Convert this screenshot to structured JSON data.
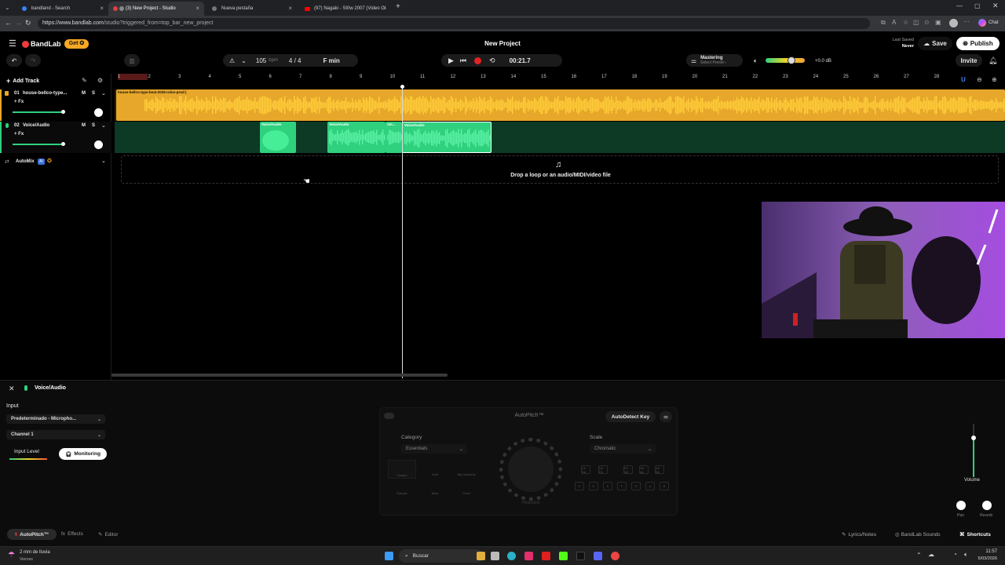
{
  "browser": {
    "tabs": [
      {
        "label": "bandland - Search",
        "active": false
      },
      {
        "label": "(3) New Project - Studio",
        "active": true
      },
      {
        "label": "Nueva pestaña",
        "active": false
      },
      {
        "label": "(97) Nagaki - SI0w 2007 (Video Cl",
        "active": false
      }
    ],
    "url_host": "https://www.bandlab.com",
    "url_path": "/studio?triggered_from=top_bar_new_project",
    "chat_label": "Chat"
  },
  "header": {
    "brand": "BandLab",
    "get_label": "Get ✪",
    "project_title": "New Project",
    "last_saved_label": "Last Saved",
    "last_saved_value": "Never",
    "save_label": "Save",
    "publish_label": "Publish",
    "invite_label": "Invite"
  },
  "transport": {
    "bpm": "105",
    "bpm_unit": "bpm",
    "time_signature": "4 / 4",
    "key": "F min",
    "time": "00:21.7",
    "mastering_label": "Mastering",
    "mastering_preset": "Select Preset ›",
    "volume_db": "+0.0 dB"
  },
  "ruler": {
    "ticks": [
      "1",
      "2",
      "3",
      "4",
      "5",
      "6",
      "7",
      "8",
      "9",
      "10",
      "11",
      "12",
      "13",
      "14",
      "15",
      "16",
      "17",
      "18",
      "19",
      "20",
      "21",
      "22",
      "23",
      "24",
      "25",
      "26",
      "27",
      "28"
    ]
  },
  "tracks": {
    "add_track_label": "Add Track",
    "list": [
      {
        "num": "01",
        "name": "house-bellco-type...",
        "fx": "+ Fx",
        "m": "M",
        "s": "S"
      },
      {
        "num": "02",
        "name": "Voice/Audio",
        "fx": "+ Fx",
        "m": "M",
        "s": "S"
      }
    ],
    "automix_label": "AutoMix",
    "automix_badge": "AI",
    "clip1_label": "house-bellco-type-beat-2025-rolov-prod (",
    "voice_clip_labels": [
      "Voice/Audio",
      "Voice/Audio",
      "Voi...",
      "Voice/Audio"
    ],
    "drop_text": "Drop a loop or an audio/MIDI/video file"
  },
  "panel": {
    "track_name": "Voice/Audio",
    "input_heading": "Input",
    "input_device": "Predeterminado - Micropho...",
    "channel": "Channel 1",
    "input_level_label": "Input Level",
    "monitoring_label": "Monitoring",
    "autopitch_title": "AutoPitch™",
    "autodetect_label": "AutoDetect Key",
    "category_label": "Category",
    "category_value": "Essentials",
    "scale_label": "Scale",
    "scale_value": "Chromatic",
    "presets_row1": [
      "Classic",
      "Duet",
      "Big Harmony"
    ],
    "presets_row2": [
      "Robotic",
      "Wow",
      "Choir"
    ],
    "knob_label": "Heaviest",
    "keys_top": [
      "C#\nDb",
      "D#\nEb",
      "F#\nGb",
      "G#\nAb",
      "A#\nBb"
    ],
    "keys_bottom": [
      "C",
      "D",
      "E",
      "F",
      "G",
      "A",
      "B"
    ],
    "volume_label": "Volume",
    "pan_label": "Pan",
    "reverb_label": "Reverb",
    "bottom_tabs": [
      "AutoPitch™",
      "Effects",
      "Editor"
    ],
    "lyrics_label": "Lyrics/Notes",
    "sounds_label": "BandLab Sounds",
    "shortcuts_label": "Shortcuts"
  },
  "taskbar": {
    "weather_main": "2 mm de lluvia",
    "weather_sub": "Viernes",
    "search_label": "Buscar",
    "time": "11:57",
    "date": "5/03/2026"
  },
  "colors": {
    "brand_red": "#f03c3c",
    "get_orange": "#f7a823",
    "track1_gold": "#e7a72a",
    "track2_green": "#2fd07e"
  }
}
